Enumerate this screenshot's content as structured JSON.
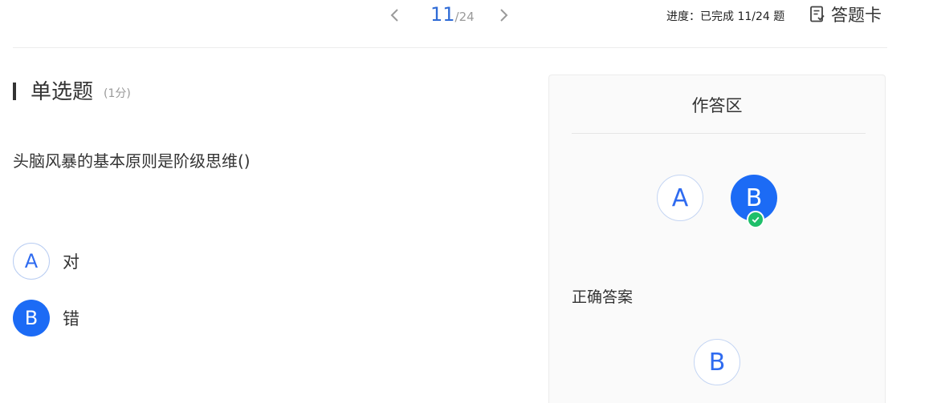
{
  "navigation": {
    "prev_icon": "chevron-left-icon",
    "next_icon": "chevron-right-icon",
    "current": "11",
    "total": "/24"
  },
  "progress": {
    "text": "进度：已完成 11/24 题"
  },
  "answer_card": {
    "icon": "answer-sheet-icon",
    "label": "答题卡"
  },
  "question": {
    "type": "单选题",
    "score": "(1分)",
    "text": "头脑风暴的基本原则是阶级思维()",
    "options": [
      {
        "letter": "A",
        "text": "对",
        "selected": false
      },
      {
        "letter": "B",
        "text": "错",
        "selected": true
      }
    ]
  },
  "answer_panel": {
    "title": "作答区",
    "choices": [
      {
        "letter": "A",
        "selected": false
      },
      {
        "letter": "B",
        "selected": true
      }
    ],
    "check_icon": "check-circle-icon",
    "correct_label": "正确答案",
    "correct_answer": "B"
  },
  "colors": {
    "accent": "#1c6bf5",
    "accent_text": "#2f6bd6",
    "success": "#1fbf6a",
    "panel_bg": "#fafafa"
  }
}
